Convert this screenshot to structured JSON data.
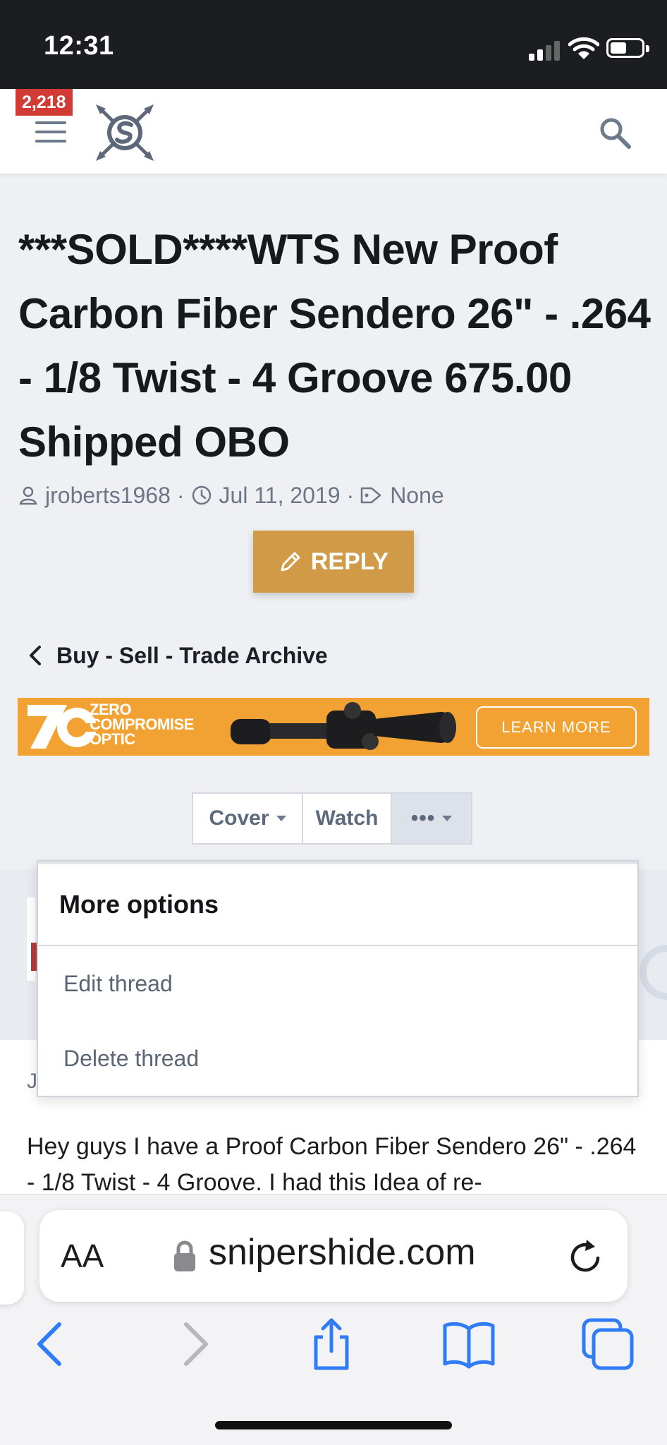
{
  "status_bar": {
    "time": "12:31"
  },
  "header": {
    "notification_count": "2,218",
    "menu_icon": "hamburger-icon",
    "logo_icon": "snipers-hide-logo",
    "search_icon": "search-icon"
  },
  "thread": {
    "title": "***SOLD****WTS New Proof Carbon Fiber Sendero 26\" - .264 - 1/8 Twist - 4 Groove 675.00 Shipped OBO",
    "author": "jroberts1968",
    "date": "Jul 11, 2019",
    "tags": "None",
    "reply_label": "REPLY"
  },
  "breadcrumb": {
    "label": "Buy - Sell - Trade Archive"
  },
  "ad": {
    "brand_line1": "ZERO",
    "brand_line2": "COMPROMISE",
    "brand_line3": "OPTIC",
    "cta": "LEARN MORE",
    "color": "#f1a233"
  },
  "actions": {
    "cover_label": "Cover",
    "watch_label": "Watch",
    "more_label": "•••"
  },
  "more_menu": {
    "heading": "More options",
    "items": [
      {
        "label": "Edit thread"
      },
      {
        "label": "Delete thread"
      }
    ]
  },
  "post": {
    "author_initial": "J",
    "body": "Hey guys I have a Proof Carbon Fiber Sendero 26\" - .264 - 1/8 Twist - 4 Groove. I had this Idea of re-"
  },
  "browser": {
    "aa_label": "AA",
    "domain": "snipershide.com"
  },
  "colors": {
    "reply_button": "#d19a46",
    "badge": "#d13b33",
    "ios_blue": "#2f7cf6"
  }
}
